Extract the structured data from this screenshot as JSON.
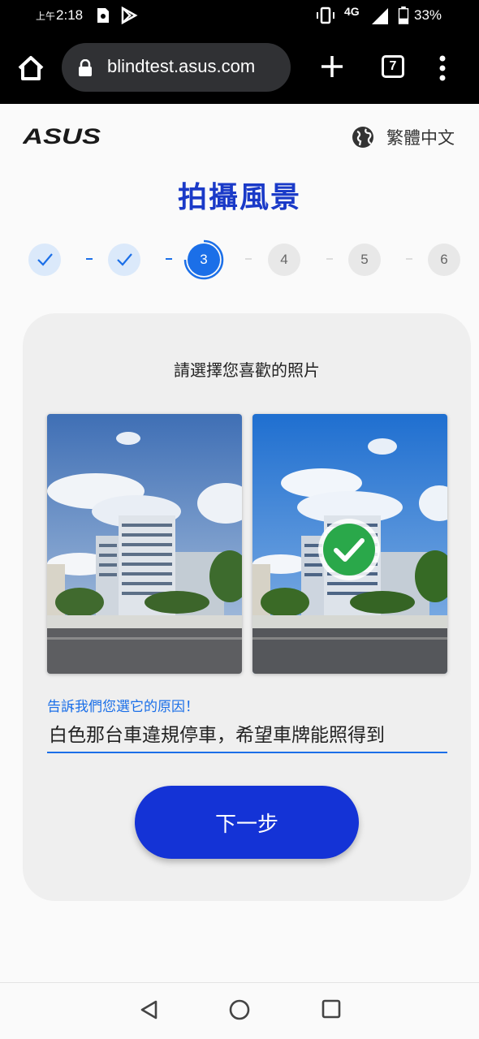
{
  "status_bar": {
    "time_prefix": "上午",
    "time": "2:18",
    "network": "4G",
    "battery": "33%"
  },
  "browser": {
    "url": "blindtest.asus.com",
    "tab_count": "7"
  },
  "header": {
    "logo_text": "ASUS",
    "language": "繁體中文"
  },
  "page": {
    "title": "拍攝風景",
    "steps": [
      {
        "label": "",
        "state": "done"
      },
      {
        "label": "",
        "state": "done"
      },
      {
        "label": "3",
        "state": "current"
      },
      {
        "label": "4",
        "state": "upcoming"
      },
      {
        "label": "5",
        "state": "upcoming"
      },
      {
        "label": "6",
        "state": "upcoming"
      }
    ],
    "prompt": "請選擇您喜歡的照片",
    "selected_photo": "right",
    "reason_label": "告訴我們您選它的原因！",
    "reason_value": "白色那台車違規停車，希望車牌能照得到",
    "next_button": "下一步"
  },
  "colors": {
    "accent": "#1b6fe8",
    "title": "#1a3ac8",
    "button": "#1433d6",
    "check": "#2aa84a"
  }
}
